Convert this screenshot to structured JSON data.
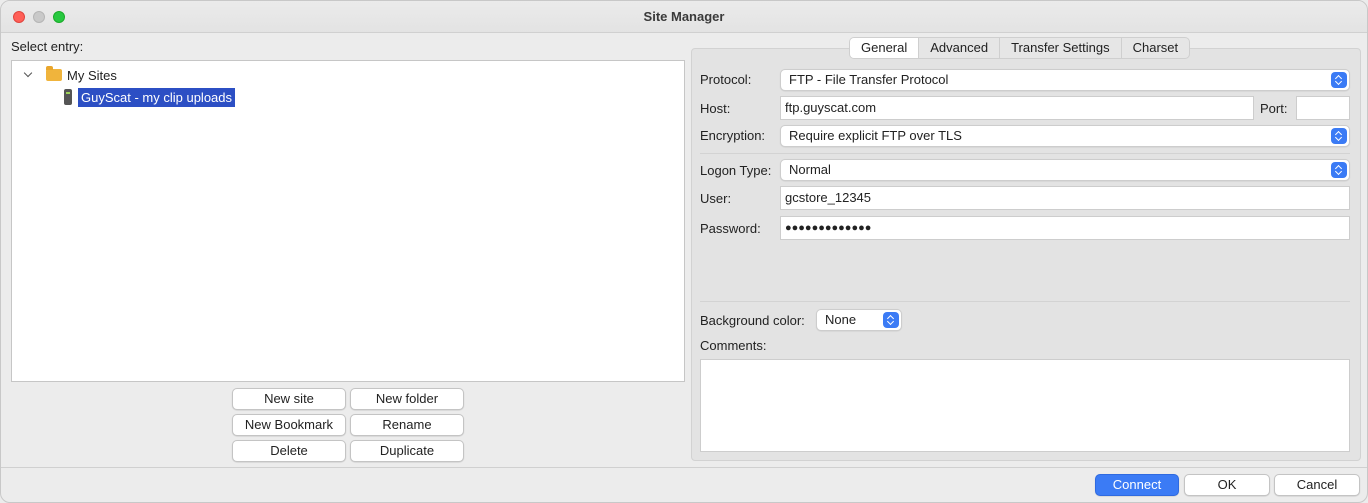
{
  "window": {
    "title": "Site Manager"
  },
  "left": {
    "select_entry_label": "Select entry:",
    "tree": {
      "root_label": "My Sites",
      "site_label": "GuyScat - my clip uploads"
    },
    "buttons": {
      "new_site": "New site",
      "new_folder": "New folder",
      "new_bookmark": "New Bookmark",
      "rename": "Rename",
      "delete": "Delete",
      "duplicate": "Duplicate"
    }
  },
  "tabs": {
    "general": "General",
    "advanced": "Advanced",
    "transfer_settings": "Transfer Settings",
    "charset": "Charset"
  },
  "general": {
    "protocol_label": "Protocol:",
    "protocol_value": "FTP - File Transfer Protocol",
    "host_label": "Host:",
    "host_value": "ftp.guyscat.com",
    "port_label": "Port:",
    "port_value": "",
    "encryption_label": "Encryption:",
    "encryption_value": "Require explicit FTP over TLS",
    "logon_type_label": "Logon Type:",
    "logon_type_value": "Normal",
    "user_label": "User:",
    "user_value": "gcstore_12345",
    "password_label": "Password:",
    "password_value": "●●●●●●●●●●●●●",
    "background_color_label": "Background color:",
    "background_color_value": "None",
    "comments_label": "Comments:"
  },
  "footer": {
    "connect": "Connect",
    "ok": "OK",
    "cancel": "Cancel"
  },
  "colors": {
    "accent": "#3b7bf5",
    "selection": "#2c4fc4"
  }
}
